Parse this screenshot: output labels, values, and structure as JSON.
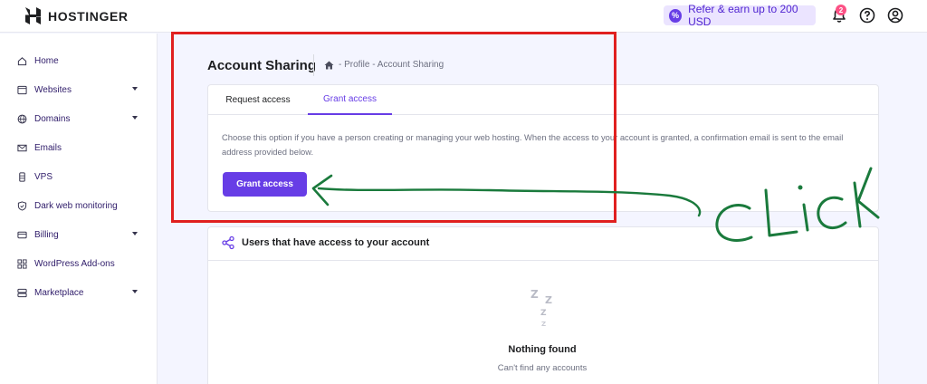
{
  "header": {
    "logo_text": "HOSTINGER",
    "refer_label": "Refer & earn up to 200 USD",
    "notification_count": "2"
  },
  "sidebar": {
    "items": [
      {
        "label": "Home",
        "icon": "home-icon",
        "expandable": false
      },
      {
        "label": "Websites",
        "icon": "websites-icon",
        "expandable": true
      },
      {
        "label": "Domains",
        "icon": "globe-icon",
        "expandable": true
      },
      {
        "label": "Emails",
        "icon": "mail-icon",
        "expandable": false
      },
      {
        "label": "VPS",
        "icon": "server-icon",
        "expandable": false
      },
      {
        "label": "Dark web monitoring",
        "icon": "shield-icon",
        "expandable": false
      },
      {
        "label": "Billing",
        "icon": "billing-icon",
        "expandable": true
      },
      {
        "label": "WordPress Add-ons",
        "icon": "addons-icon",
        "expandable": false
      },
      {
        "label": "Marketplace",
        "icon": "marketplace-icon",
        "expandable": true
      }
    ]
  },
  "main": {
    "title": "Account Sharing",
    "breadcrumb": "- Profile - Account Sharing",
    "tabs": [
      {
        "label": "Request access",
        "active": false
      },
      {
        "label": "Grant access",
        "active": true
      }
    ],
    "description": "Choose this option if you have a person creating or managing your web hosting. When the access to your account is granted, a confirmation email is sent to the email address provided below.",
    "grant_button": "Grant access",
    "users_section_title": "Users that have access to your account",
    "empty_title": "Nothing found",
    "empty_subtitle": "Can't find any accounts"
  },
  "annotation": {
    "handwritten_text": "CLICK"
  },
  "colors": {
    "accent": "#673de6",
    "annotation_red": "#e0201f",
    "annotation_green": "#1a7a3c"
  }
}
